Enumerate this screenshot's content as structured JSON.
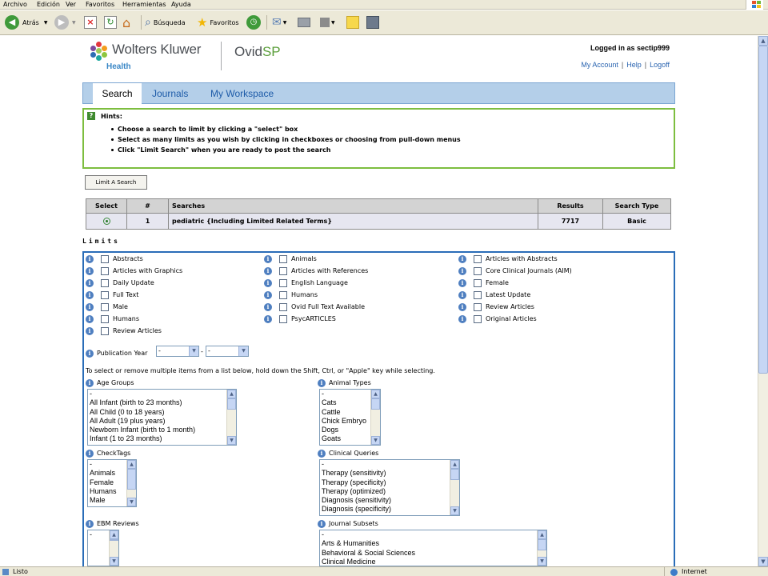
{
  "browser": {
    "menu": [
      "Archivo",
      "Edición",
      "Ver",
      "Favoritos",
      "Herramientas",
      "Ayuda"
    ],
    "back_label": "Atrás",
    "search_label": "Búsqueda",
    "favorites_label": "Favoritos",
    "status_left": "Listo",
    "status_zone": "Internet"
  },
  "header": {
    "brand": "Wolters Kluwer",
    "brand_sub": "Health",
    "product_a": "Ovid",
    "product_b": "SP",
    "logged_in": "Logged in as sectip999",
    "links": [
      "My Account",
      "Help",
      "Logoff"
    ]
  },
  "nav": {
    "tabs": [
      "Search",
      "Journals",
      "My Workspace"
    ]
  },
  "hints": {
    "title": "Hints:",
    "items": [
      "Choose a search to limit by clicking a \"select\" box",
      "Select as many limits as you wish by clicking in checkboxes or choosing from pull-down menus",
      "Click \"Limit Search\" when you are ready to post the search"
    ]
  },
  "limit_button": "Limit A Search",
  "search_table": {
    "headers": [
      "Select",
      "#",
      "Searches",
      "Results",
      "Search Type"
    ],
    "rows": [
      {
        "num": "1",
        "search": "pediatric {Including Limited Related Terms}",
        "results": "7717",
        "type": "Basic"
      }
    ]
  },
  "limits": {
    "title": "Limits",
    "col1": [
      "Abstracts",
      "Articles with Graphics",
      "Daily Update",
      "Full Text",
      "Male",
      "Humans",
      "Review Articles"
    ],
    "col2": [
      "Animals",
      "Articles with References",
      "English Language",
      "Humans",
      "Ovid Full Text Available",
      "PsycARTICLES"
    ],
    "col3": [
      "Articles with Abstracts",
      "Core Clinical Journals (AIM)",
      "Female",
      "Latest Update",
      "Review Articles",
      "Original Articles"
    ],
    "pub_year_label": "Publication Year",
    "pub_year_from": "-",
    "pub_year_to": "-",
    "pub_year_sep": "-",
    "multi_hint": "To select or remove multiple items from a list below, hold down the Shift, Ctrl, or \"Apple\" key while selecting.",
    "age_groups": {
      "label": "Age Groups",
      "options": [
        "-",
        "All Infant (birth to 23 months)",
        "All Child (0 to 18 years)",
        "All Adult (19 plus years)",
        "Newborn Infant (birth to 1 month)",
        "Infant (1 to 23 months)"
      ]
    },
    "animal_types": {
      "label": "Animal Types",
      "options": [
        "-",
        "Cats",
        "Cattle",
        "Chick Embryo",
        "Dogs",
        "Goats"
      ]
    },
    "checktags": {
      "label": "CheckTags",
      "options": [
        "-",
        "Animals",
        "Female",
        "Humans",
        "Male"
      ]
    },
    "clinical_queries": {
      "label": "Clinical Queries",
      "options": [
        "-",
        "Therapy (sensitivity)",
        "Therapy (specificity)",
        "Therapy (optimized)",
        "Diagnosis (sensitivity)",
        "Diagnosis (specificity)"
      ]
    },
    "ebm_reviews": {
      "label": "EBM Reviews",
      "options": [
        "-"
      ]
    },
    "journal_subsets": {
      "label": "Journal Subsets",
      "options": [
        "-",
        "Arts & Humanities",
        "Behavioral & Social Sciences",
        "Clinical Medicine"
      ]
    }
  }
}
